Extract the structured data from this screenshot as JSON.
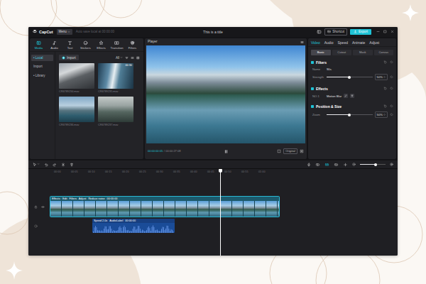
{
  "window": {
    "logo": "CapCut",
    "menu": "Menu",
    "autosave": "Auto save local at 00:00:00",
    "title": "This is a title",
    "shortcut": "Shortcut",
    "export": "Export"
  },
  "toolbar": {
    "tabs": [
      {
        "label": "Media",
        "selected": true
      },
      {
        "label": "Audio",
        "selected": false
      },
      {
        "label": "Text",
        "selected": false
      },
      {
        "label": "Stickers",
        "selected": false
      },
      {
        "label": "Effects",
        "selected": false
      },
      {
        "label": "Transition",
        "selected": false
      },
      {
        "label": "Filters",
        "selected": false
      }
    ]
  },
  "sidebar": {
    "items": [
      {
        "label": "• Local",
        "selected": true
      },
      {
        "label": "Import",
        "selected": false
      },
      {
        "label": "• Library",
        "selected": false
      }
    ]
  },
  "media": {
    "import": "Import",
    "filter": "All",
    "items": [
      {
        "name": "CR6789234.mov"
      },
      {
        "name": "CR6789235.mov",
        "duration": "00:30"
      },
      {
        "name": "CR6789236.mov"
      },
      {
        "name": "CR6789237.mov"
      }
    ]
  },
  "player": {
    "title": "Player",
    "current": "00:00:00:05",
    "separator": "/",
    "total": "00:00:27:08",
    "playing": true,
    "ratio": "Original"
  },
  "inspector": {
    "tabs": [
      {
        "label": "Video",
        "selected": true
      },
      {
        "label": "Audio",
        "selected": false
      },
      {
        "label": "Speed",
        "selected": false
      },
      {
        "label": "Animate",
        "selected": false
      },
      {
        "label": "Adjust",
        "selected": false
      }
    ],
    "subtabs": [
      {
        "label": "Basic",
        "selected": true
      },
      {
        "label": "Cutout",
        "selected": false
      },
      {
        "label": "Mask",
        "selected": false
      },
      {
        "label": "Canvas",
        "selected": false
      }
    ],
    "sections": [
      {
        "title": "Filters",
        "enabled": true,
        "rows": [
          {
            "kind": "text",
            "label": "Name",
            "value": "90s"
          },
          {
            "kind": "slider",
            "label": "Strength",
            "level": 0.5,
            "reading": "50%"
          }
        ]
      },
      {
        "title": "Effects",
        "enabled": true,
        "rows": [
          {
            "kind": "effect",
            "label": "NO.1",
            "value": "Motion Blur"
          }
        ]
      },
      {
        "title": "Position & Size",
        "enabled": true,
        "rows": [
          {
            "kind": "slider",
            "label": "Zoom",
            "level": 0.5,
            "reading": "50%"
          }
        ]
      }
    ]
  },
  "timeline": {
    "toggles": [
      {
        "on": false
      },
      {
        "on": true
      },
      {
        "on": false
      },
      {
        "on": false
      }
    ],
    "zoom": {
      "level": 0.6
    },
    "ruler": [
      "00:00",
      "00:05",
      "00:10",
      "00:15",
      "00:20",
      "00:25",
      "00:30",
      "00:35",
      "00:40",
      "00:45",
      "00:50",
      "00:55",
      "01:00"
    ],
    "playhead": 0.49,
    "video_clip": {
      "tags": [
        "Effects · Edit",
        "Filters",
        "Adjust",
        "Reduce noise",
        "00:00:00"
      ]
    },
    "audio_clip": {
      "tags": [
        "Speed 2.0x",
        "AudioLabel",
        "00:00:00"
      ]
    }
  }
}
